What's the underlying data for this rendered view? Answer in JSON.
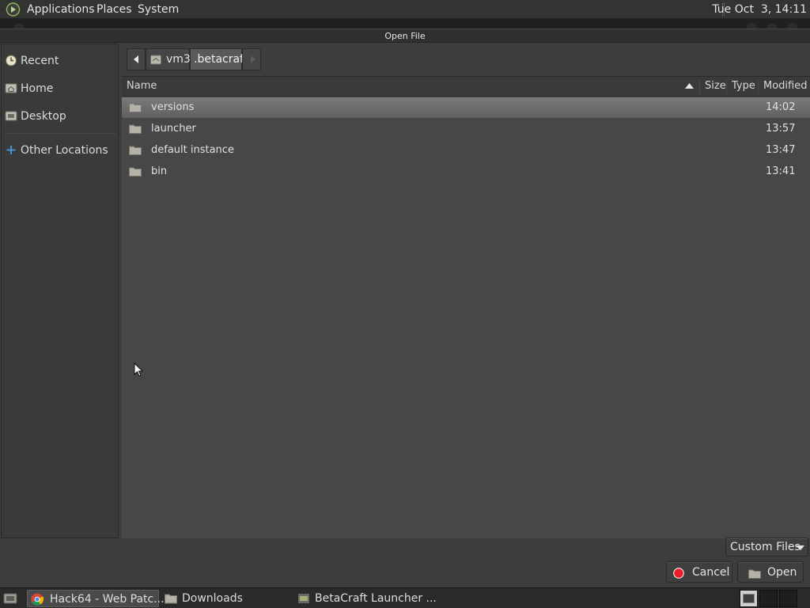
{
  "top_panel": {
    "menus": [
      "Applications",
      "Places",
      "System"
    ],
    "clock": "Tue Oct  3, 14:11"
  },
  "dialog": {
    "title": "Open File",
    "sidebar": [
      {
        "label": "Recent",
        "icon": "recent-icon"
      },
      {
        "label": "Home",
        "icon": "home-folder-icon"
      },
      {
        "label": "Desktop",
        "icon": "desktop-icon"
      },
      {
        "label": "Other Locations",
        "icon": "plus-icon"
      }
    ],
    "path": {
      "segments": [
        "vm3",
        ".betacraft"
      ]
    },
    "columns": {
      "name": "Name",
      "size": "Size",
      "type": "Type",
      "modified": "Modified"
    },
    "files": [
      {
        "name": "versions",
        "modified": "14:02"
      },
      {
        "name": "launcher",
        "modified": "13:57"
      },
      {
        "name": "default instance",
        "modified": "13:47"
      },
      {
        "name": "bin",
        "modified": "13:41"
      }
    ],
    "filter": "Custom Files",
    "cancel_label": "Cancel",
    "open_label": "Open"
  },
  "taskbar": {
    "tasks": [
      {
        "label": "Hack64 - Web Patc...",
        "icon": "chrome-icon"
      },
      {
        "label": "Downloads",
        "icon": "folder-icon"
      },
      {
        "label": "BetaCraft Launcher ...",
        "icon": "betacraft-icon"
      }
    ]
  },
  "colors": {
    "selection": "#6e6e6e",
    "cancel_red": "#e8202a",
    "plus_blue": "#4a90d9"
  }
}
